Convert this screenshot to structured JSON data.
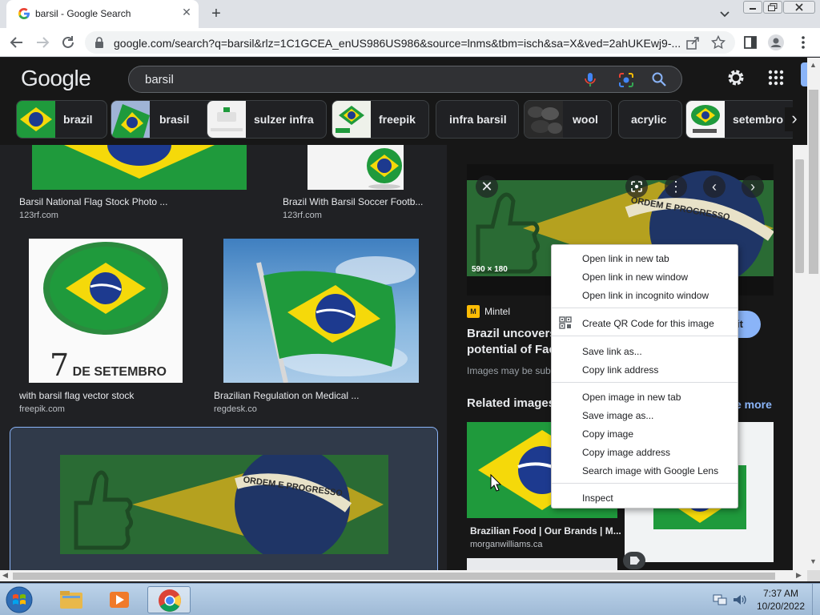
{
  "browser": {
    "tab_title": "barsil - Google Search",
    "url": "google.com/search?q=barsil&rlz=1C1GCEA_enUS986US986&source=lnms&tbm=isch&sa=X&ved=2ahUKEwj9-..."
  },
  "google": {
    "logo": "Google",
    "query": "barsil",
    "chips": [
      "brazil",
      "brasil",
      "sulzer infra",
      "freepik",
      "infra barsil",
      "wool",
      "acrylic",
      "setembro"
    ]
  },
  "results": [
    {
      "title": "Barsil National Flag Stock Photo ...",
      "source": "123rf.com"
    },
    {
      "title": "Brazil With Barsil Soccer Footb...",
      "source": "123rf.com"
    },
    {
      "title": "with barsil flag vector stock",
      "source": "freepik.com",
      "caption": "7 DE SETEMBRO",
      "caption_num": "7",
      "caption_rest": "DE SETEMBRO"
    },
    {
      "title": "Brazilian Regulation on Medical ...",
      "source": "regdesk.co"
    }
  ],
  "flag_motto": "ORDEM E PROGRESSO",
  "preview": {
    "dimensions": "590 × 180",
    "source": "Mintel",
    "source_logo": "M",
    "title_line1": "Brazil uncovers",
    "title_line2": "potential of Fac",
    "visit_label": "it",
    "note": "Images may be sub",
    "related_heading": "Related images",
    "see_more": "e more",
    "related": [
      {
        "title": "Brazilian Food | Our Brands | M...",
        "source": "morganwilliams.ca"
      }
    ]
  },
  "context_menu": {
    "items": [
      "Open link in new tab",
      "Open link in new window",
      "Open link in incognito window",
      "Create QR Code for this image",
      "Save link as...",
      "Copy link address",
      "Open image in new tab",
      "Save image as...",
      "Copy image",
      "Copy image address",
      "Search image with Google Lens",
      "Inspect"
    ]
  },
  "taskbar": {
    "time": "7:37 AM",
    "date": "10/20/2022"
  },
  "colors": {
    "flag_green": "#1f9a3c",
    "flag_yellow": "#f5d90a",
    "flag_blue": "#1d3a8f",
    "page_bg": "#202124",
    "accent": "#8ab4f8"
  }
}
